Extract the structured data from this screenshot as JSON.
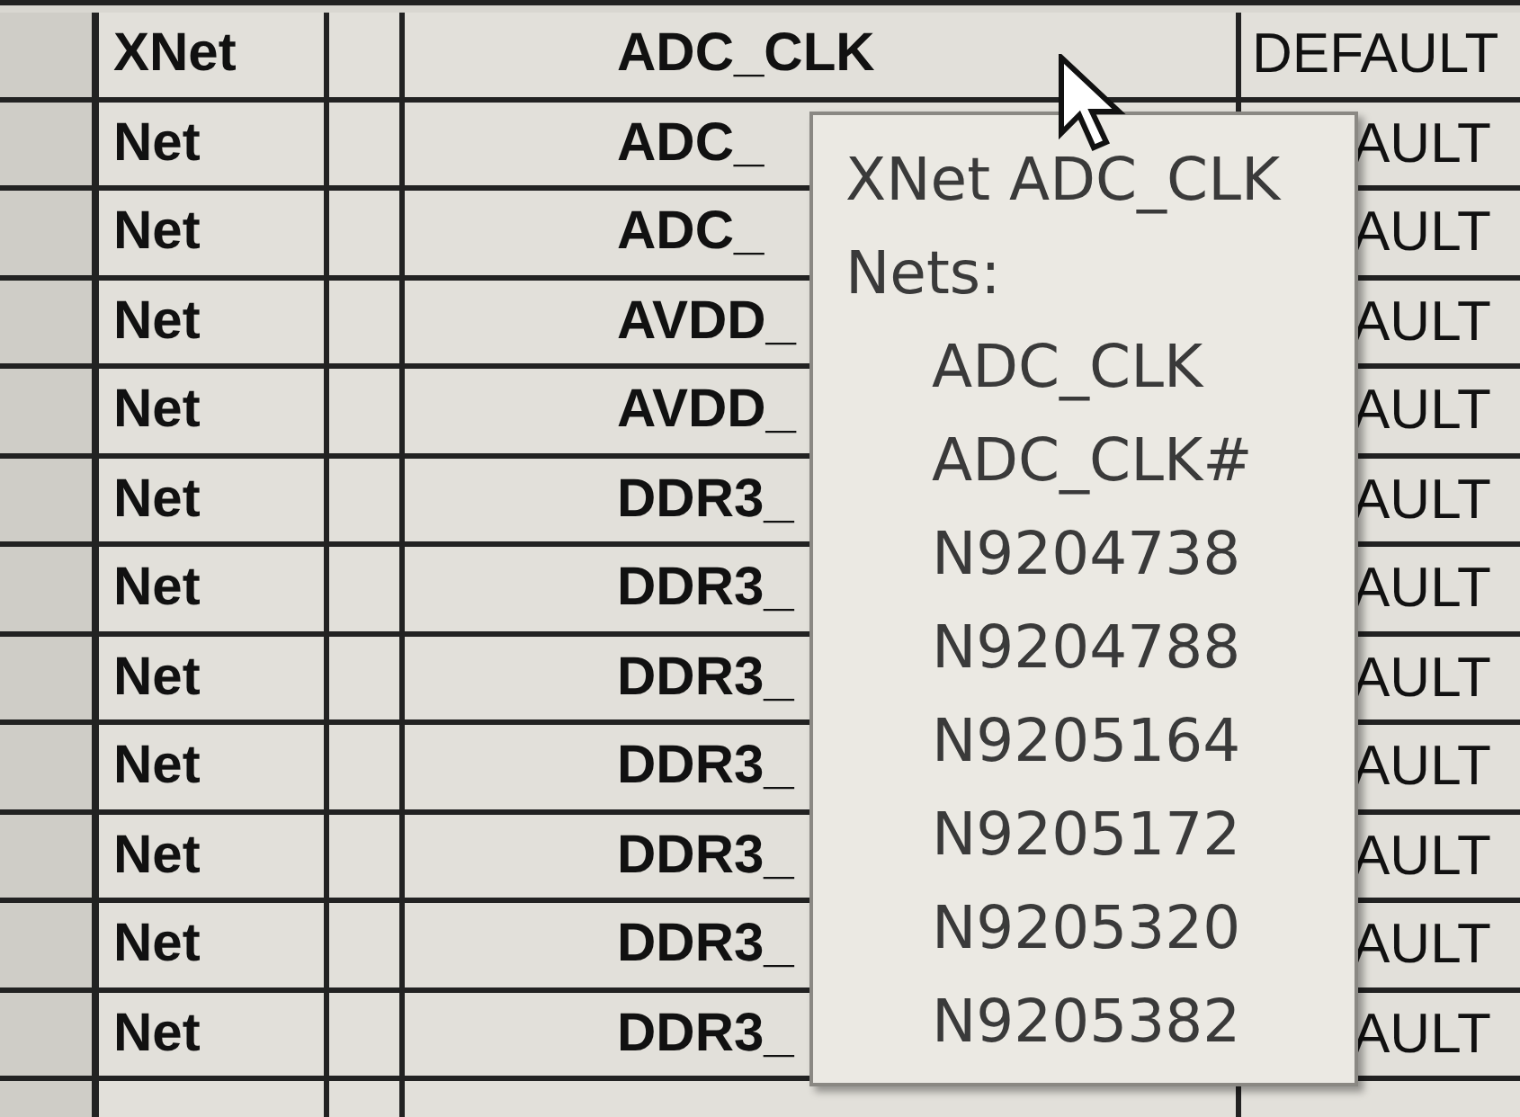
{
  "rows": [
    {
      "type": "XNet",
      "name": "ADC_CLK",
      "status": "DEFAULT"
    },
    {
      "type": "Net",
      "name": "ADC_",
      "status": "AULT"
    },
    {
      "type": "Net",
      "name": "ADC_",
      "status": "AULT"
    },
    {
      "type": "Net",
      "name": "AVDD_",
      "status": "AULT"
    },
    {
      "type": "Net",
      "name": "AVDD_",
      "status": "AULT"
    },
    {
      "type": "Net",
      "name": "DDR3_",
      "status": "AULT"
    },
    {
      "type": "Net",
      "name": "DDR3_",
      "status": "AULT"
    },
    {
      "type": "Net",
      "name": "DDR3_",
      "status": "AULT"
    },
    {
      "type": "Net",
      "name": "DDR3_",
      "status": "AULT"
    },
    {
      "type": "Net",
      "name": "DDR3_",
      "status": "AULT"
    },
    {
      "type": "Net",
      "name": "DDR3_",
      "status": "AULT"
    },
    {
      "type": "Net",
      "name": "DDR3_",
      "status": "AULT"
    }
  ],
  "tooltip": {
    "title": "XNet ADC_CLK",
    "label": "Nets:",
    "nets": [
      "ADC_CLK",
      "ADC_CLK#",
      "N9204738",
      "N9204788",
      "N9205164",
      "N9205172",
      "N9205320",
      "N9205382"
    ]
  }
}
